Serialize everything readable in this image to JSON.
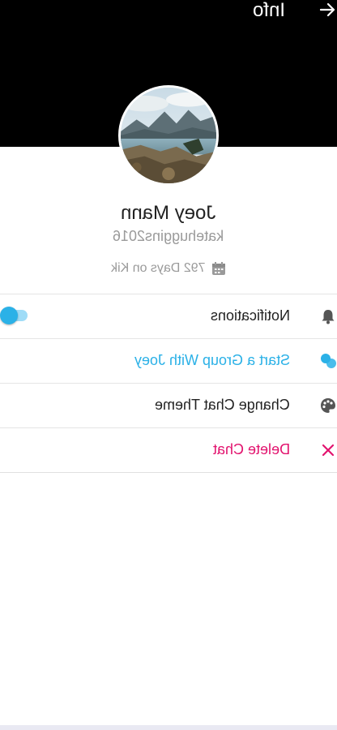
{
  "header": {
    "title": "Info",
    "back_icon": "arrow-icon"
  },
  "profile": {
    "name": "Joey Mann",
    "username": "katehuggins2016",
    "days_on_kik": "792 Days on Kik",
    "calendar_icon": "calendar-icon"
  },
  "menu": {
    "items": [
      {
        "label": "Notifications",
        "icon": "bell-icon",
        "color": "#222222",
        "toggle_on": true
      },
      {
        "label": "Start a Group With Joey",
        "icon": "group-icon",
        "color": "#2bb1e7"
      },
      {
        "label": "Change Chat Theme",
        "icon": "palette-icon",
        "color": "#222222"
      },
      {
        "label": "Delete Chat",
        "icon": "close-icon",
        "color": "#e2136e"
      }
    ]
  },
  "colors": {
    "accent": "#2bb1e7",
    "danger": "#e2136e",
    "header_bg": "#000000"
  }
}
